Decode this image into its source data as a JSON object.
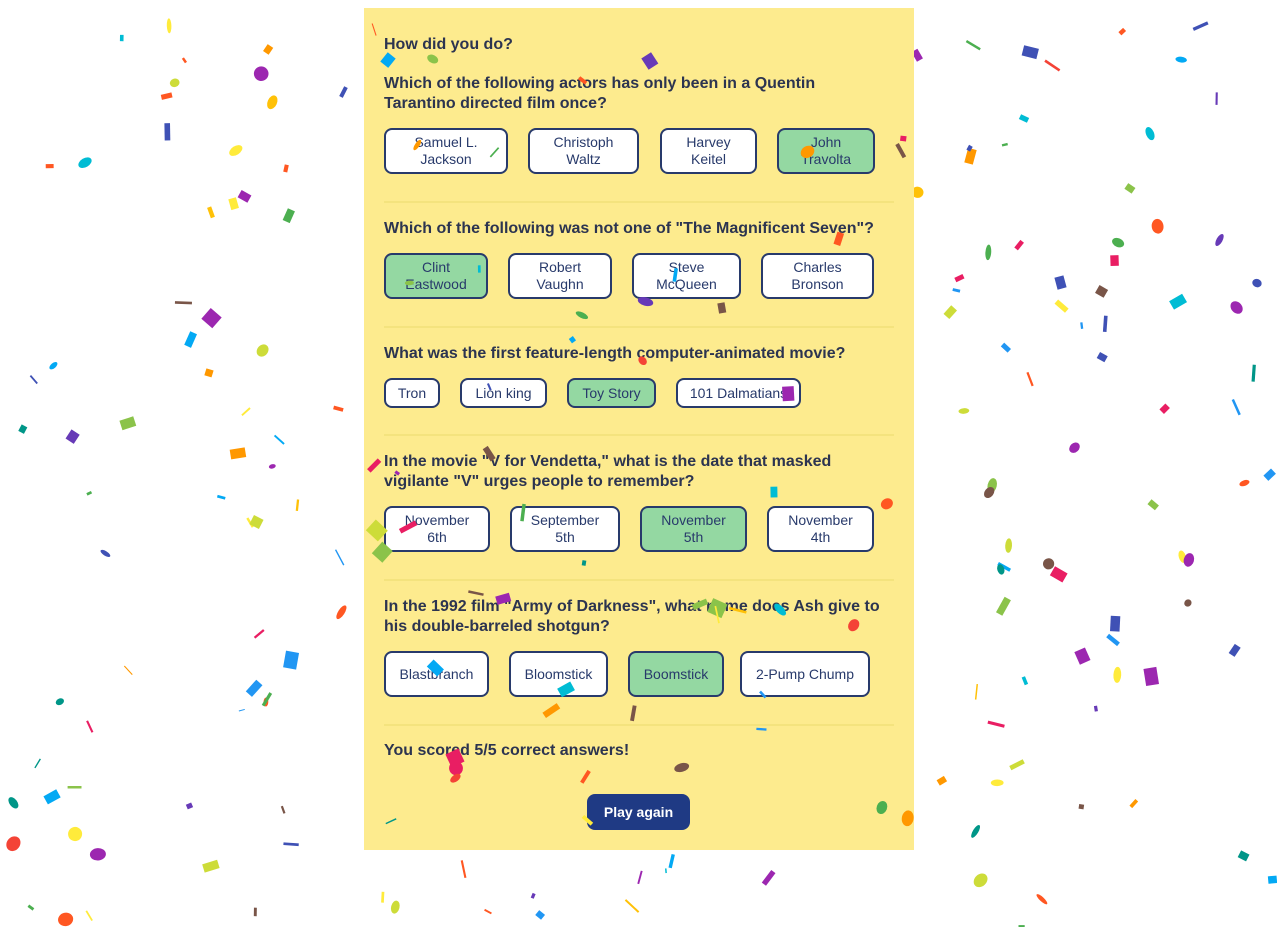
{
  "quiz": {
    "heading": "How did you do?",
    "questions": [
      {
        "text": "Which of the following actors has only been in a Quentin Tarantino directed film once?",
        "answers": [
          "Samuel L. Jackson",
          "Christoph Waltz",
          "Harvey Keitel",
          "John Travolta"
        ],
        "selected_index": 3
      },
      {
        "text": "Which of the following was not one of \"The Magnificent Seven\"?",
        "answers": [
          "Clint Eastwood",
          "Robert Vaughn",
          "Steve McQueen",
          "Charles Bronson"
        ],
        "selected_index": 0
      },
      {
        "text": "What was the first feature-length computer-animated movie?",
        "answers": [
          "Tron",
          "Lion king",
          "Toy Story",
          "101 Dalmatians"
        ],
        "selected_index": 2
      },
      {
        "text": "In the movie \"V for Vendetta,\" what is the date that masked vigilante \"V\" urges people to remember?",
        "answers": [
          "November 6th",
          "September 5th",
          "November 5th",
          "November 4th"
        ],
        "selected_index": 2
      },
      {
        "text": "In the 1992 film \"Army of Darkness\", what name does Ash give to his double-barreled shotgun?",
        "answers": [
          "Blastbranch",
          "Bloomstick",
          "Boomstick",
          "2-Pump Chump"
        ],
        "selected_index": 2
      }
    ],
    "score_text": "You scored 5/5 correct answers!",
    "play_again_label": "Play again"
  },
  "colors": {
    "panel_bg": "#fdeb8e",
    "selected_answer_bg": "#94d8a2",
    "answer_border": "#283a6b",
    "button_bg": "#1f3a84",
    "text": "#2c3450"
  },
  "confetti_palette": [
    "#e91e63",
    "#673ab7",
    "#3f51b5",
    "#03a9f4",
    "#009688",
    "#8bc34a",
    "#cddc39",
    "#ffeb3b",
    "#ffc107",
    "#ff5722",
    "#795548",
    "#9c27b0",
    "#2196f3",
    "#00bcd4",
    "#ff9800",
    "#f44336",
    "#4caf50"
  ]
}
